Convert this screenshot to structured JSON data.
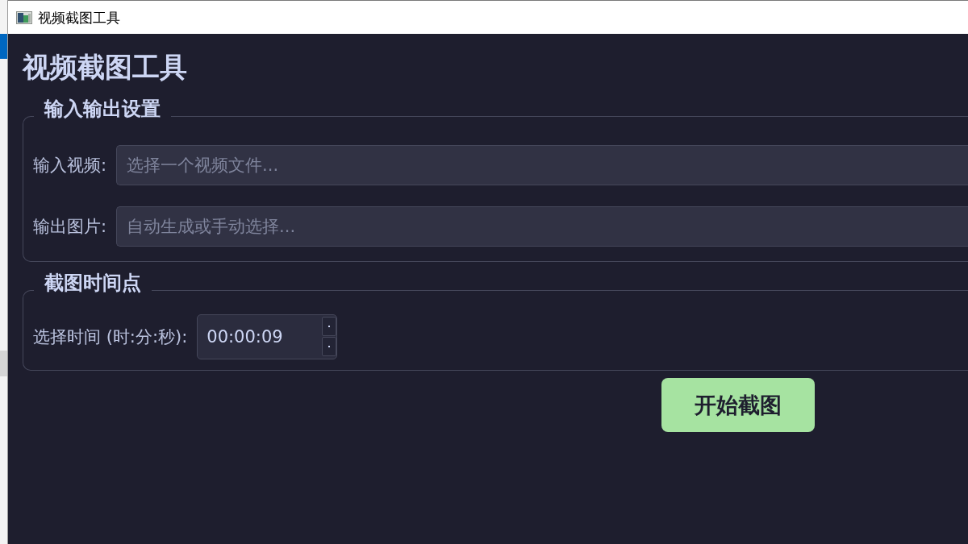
{
  "window": {
    "title": "视频截图工具"
  },
  "heading": "视频截图工具",
  "groups": [
    {
      "title": "输入输出设置",
      "rows": [
        {
          "kind": "text",
          "label": "输入视频:",
          "placeholder": "选择一个视频文件..."
        },
        {
          "kind": "text",
          "label": "输出图片:",
          "placeholder": "自动生成或手动选择..."
        }
      ]
    },
    {
      "title": "截图时间点",
      "rows": [
        {
          "kind": "time",
          "label": "选择时间 (时:分:秒):",
          "value": "00:00:09"
        }
      ]
    }
  ],
  "action_button": {
    "label": "开始截图"
  }
}
